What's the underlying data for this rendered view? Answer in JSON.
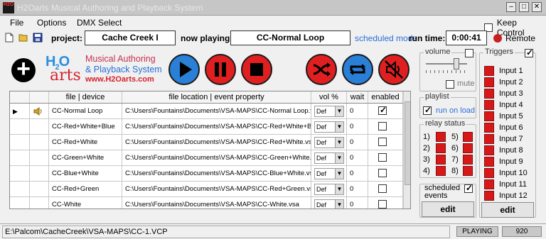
{
  "window": {
    "title": "H2Oarts Musical Authoring and Playback System",
    "icon_text": "H2O"
  },
  "menu": {
    "items": [
      "File",
      "Options",
      "DMX Select"
    ],
    "keep_control": "Keep Control",
    "keep_control_checked": false
  },
  "toolbar": {
    "project_label": "project:",
    "project_value": "Cache Creek I",
    "now_playing_label": "now playing:",
    "now_playing_value": "CC-Normal Loop",
    "scheduled_mode": "scheduled mode",
    "run_time_label": "run time:",
    "run_time_value": "0:00:41",
    "remote_label": "Remote",
    "accent": "#2a6fd6"
  },
  "logo": {
    "h2o": "H2O",
    "arts": "arts",
    "line1": "Musical Authoring",
    "line2": "& Playback System",
    "line3": "www.H2Oarts.com"
  },
  "transport": [
    {
      "name": "play-button",
      "icon": "play-icon",
      "color": "#2a7fd6"
    },
    {
      "name": "pause-button",
      "icon": "pause-icon",
      "color": "#e02020"
    },
    {
      "name": "stop-button",
      "icon": "stop-icon",
      "color": "#e02020"
    },
    {
      "name": "shuffle-button",
      "icon": "shuffle-icon",
      "color": "#e02020"
    },
    {
      "name": "repeat-button",
      "icon": "repeat-icon",
      "color": "#2a7fd6"
    },
    {
      "name": "mute-button",
      "icon": "mute-speaker-icon",
      "color": "#e02020"
    }
  ],
  "table": {
    "headers": [
      "file | device",
      "file location | event property",
      "vol %",
      "wait",
      "enabled"
    ],
    "rows": [
      {
        "name": "CC-Normal Loop",
        "path": "C:\\Users\\Fountains\\Documents\\VSA-MAPS\\CC-Normal Loop.vsa",
        "vol": "Def",
        "wait": "0",
        "enabled": true,
        "current": true
      },
      {
        "name": "CC-Red+White+Blue",
        "path": "C:\\Users\\Fountains\\Documents\\VSA-MAPS\\CC-Red+White+Blu...",
        "vol": "Def",
        "wait": "0",
        "enabled": false,
        "current": false
      },
      {
        "name": "CC-Red+White",
        "path": "C:\\Users\\Fountains\\Documents\\VSA-MAPS\\CC-Red+White.vsa",
        "vol": "Def",
        "wait": "0",
        "enabled": false,
        "current": false
      },
      {
        "name": "CC-Green+White",
        "path": "C:\\Users\\Fountains\\Documents\\VSA-MAPS\\CC-Green+White.vsa",
        "vol": "Def",
        "wait": "0",
        "enabled": false,
        "current": false
      },
      {
        "name": "CC-Blue+White",
        "path": "C:\\Users\\Fountains\\Documents\\VSA-MAPS\\CC-Blue+White.vsa",
        "vol": "Def",
        "wait": "0",
        "enabled": false,
        "current": false
      },
      {
        "name": "CC-Red+Green",
        "path": "C:\\Users\\Fountains\\Documents\\VSA-MAPS\\CC-Red+Green.vsa",
        "vol": "Def",
        "wait": "0",
        "enabled": false,
        "current": false
      },
      {
        "name": "CC-White",
        "path": "C:\\Users\\Fountains\\Documents\\VSA-MAPS\\CC-White.vsa",
        "vol": "Def",
        "wait": "0",
        "enabled": false,
        "current": false
      }
    ]
  },
  "volume": {
    "label": "volume",
    "mute": "mute",
    "level": 0.85
  },
  "playlist": {
    "label": "playlist",
    "run_on_load": "run on load",
    "run_on_load_checked": true
  },
  "relay": {
    "label": "relay status",
    "items": [
      "1)",
      "2)",
      "3)",
      "4)",
      "5)",
      "6)",
      "7)",
      "8)"
    ]
  },
  "scheduled": {
    "label": "scheduled",
    "label2": "events",
    "edit": "edit"
  },
  "triggers": {
    "label": "Triggers",
    "items": [
      "Input 1",
      "Input 2",
      "Input 3",
      "Input 4",
      "Input 5",
      "Input 6",
      "Input 7",
      "Input 8",
      "Input 9",
      "Input 10",
      "Input 11",
      "Input 12"
    ],
    "edit": "edit"
  },
  "status": {
    "path": "E:\\Palcom\\CacheCreek\\VSA-MAPS\\CC-1.VCP",
    "state": "PLAYING",
    "number": "920"
  }
}
